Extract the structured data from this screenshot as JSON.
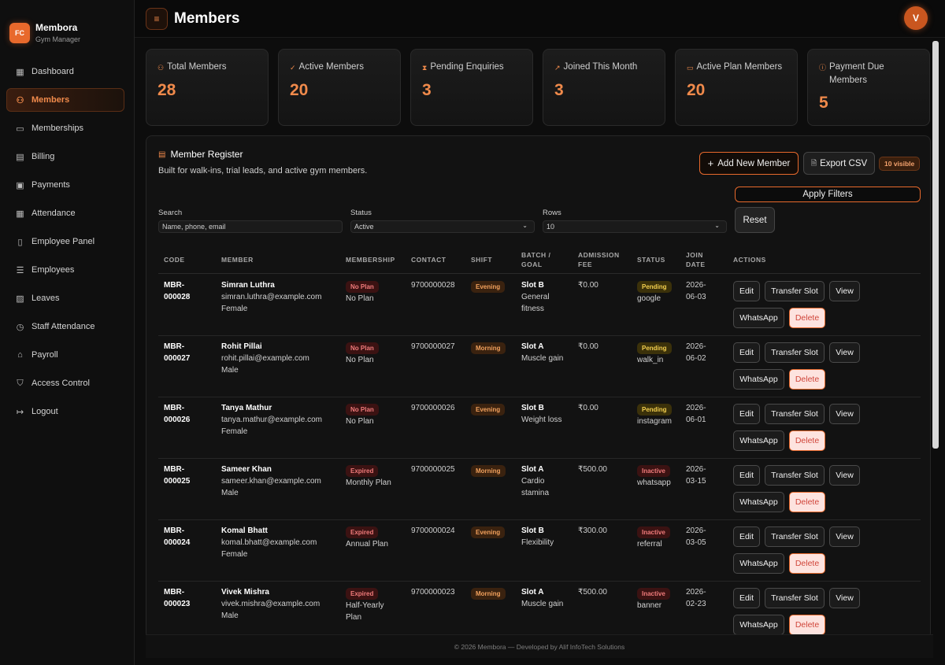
{
  "brand": {
    "logo": "FC",
    "name": "Membora",
    "sub": "Gym Manager"
  },
  "sidebar": {
    "items": [
      {
        "label": "Dashboard",
        "icon": "dashboard-icon",
        "active": false
      },
      {
        "label": "Members",
        "icon": "users-icon",
        "active": true
      },
      {
        "label": "Memberships",
        "icon": "card-icon",
        "active": false
      },
      {
        "label": "Billing",
        "icon": "billing-icon",
        "active": false
      },
      {
        "label": "Payments",
        "icon": "payments-icon",
        "active": false
      },
      {
        "label": "Attendance",
        "icon": "calendar-icon",
        "active": false
      },
      {
        "label": "Employee Panel",
        "icon": "badge-icon",
        "active": false
      },
      {
        "label": "Employees",
        "icon": "employees-icon",
        "active": false
      },
      {
        "label": "Leaves",
        "icon": "leaves-icon",
        "active": false
      },
      {
        "label": "Staff Attendance",
        "icon": "clock-icon",
        "active": false
      },
      {
        "label": "Payroll",
        "icon": "bank-icon",
        "active": false
      },
      {
        "label": "Access Control",
        "icon": "shield-icon",
        "active": false
      },
      {
        "label": "Logout",
        "icon": "logout-icon",
        "active": false
      }
    ]
  },
  "header": {
    "menu_icon": "≡",
    "title": "Members",
    "avatar": "V"
  },
  "stats": [
    {
      "label": "Total Members",
      "value": "28",
      "icon": "group-icon"
    },
    {
      "label": "Active Members",
      "value": "20",
      "icon": "user-check-icon"
    },
    {
      "label": "Pending Enquiries",
      "value": "3",
      "icon": "hourglass-icon"
    },
    {
      "label": "Joined This Month",
      "value": "3",
      "icon": "trend-icon"
    },
    {
      "label": "Active Plan Members",
      "value": "20",
      "icon": "plan-icon"
    },
    {
      "label": "Payment Due Members",
      "value": "5",
      "icon": "alert-icon"
    }
  ],
  "register": {
    "title": "Member Register",
    "subtitle": "Built for walk-ins, trial leads, and active gym members.",
    "add_label": "Add New Member",
    "export_label": "Export CSV",
    "visible_badge": "10 visible",
    "apply_label": "Apply Filters",
    "reset_label": "Reset",
    "filters": {
      "search_label": "Search",
      "search_placeholder": "Name, phone, email",
      "status_label": "Status",
      "status_value": "Active",
      "rows_label": "Rows",
      "rows_value": "10"
    }
  },
  "table": {
    "headers": {
      "code": "CODE",
      "member": "MEMBER",
      "membership": "MEMBERSHIP",
      "contact": "CONTACT",
      "shift": "SHIFT",
      "batch1": "BATCH /",
      "batch2": "GOAL",
      "fee1": "ADMISSION",
      "fee2": "FEE",
      "status": "STATUS",
      "join1": "JOIN",
      "join2": "DATE",
      "actions": "ACTIONS"
    },
    "actions": {
      "edit": "Edit",
      "transfer": "Transfer Slot",
      "view": "View",
      "whatsapp": "WhatsApp",
      "delete": "Delete"
    },
    "rows": [
      {
        "code1": "MBR-",
        "code2": "000028",
        "name": "Simran Luthra",
        "email": "simran.luthra@example.com",
        "gender": "Female",
        "plan_badge": "No Plan",
        "plan1": "No Plan",
        "plan2": "",
        "contact": "9700000028",
        "shift": "Evening",
        "slot": "Slot B",
        "goal1": "General",
        "goal2": "fitness",
        "fee": "₹0.00",
        "status": "Pending",
        "source": "google",
        "join1": "2026-",
        "join2": "06-03"
      },
      {
        "code1": "MBR-",
        "code2": "000027",
        "name": "Rohit Pillai",
        "email": "rohit.pillai@example.com",
        "gender": "Male",
        "plan_badge": "No Plan",
        "plan1": "No Plan",
        "plan2": "",
        "contact": "9700000027",
        "shift": "Morning",
        "slot": "Slot A",
        "goal1": "Muscle gain",
        "goal2": "",
        "fee": "₹0.00",
        "status": "Pending",
        "source": "walk_in",
        "join1": "2026-",
        "join2": "06-02"
      },
      {
        "code1": "MBR-",
        "code2": "000026",
        "name": "Tanya Mathur",
        "email": "tanya.mathur@example.com",
        "gender": "Female",
        "plan_badge": "No Plan",
        "plan1": "No Plan",
        "plan2": "",
        "contact": "9700000026",
        "shift": "Evening",
        "slot": "Slot B",
        "goal1": "Weight loss",
        "goal2": "",
        "fee": "₹0.00",
        "status": "Pending",
        "source": "instagram",
        "join1": "2026-",
        "join2": "06-01"
      },
      {
        "code1": "MBR-",
        "code2": "000025",
        "name": "Sameer Khan",
        "email": "sameer.khan@example.com",
        "gender": "Male",
        "plan_badge": "Expired",
        "plan1": "Monthly Plan",
        "plan2": "",
        "contact": "9700000025",
        "shift": "Morning",
        "slot": "Slot A",
        "goal1": "Cardio",
        "goal2": "stamina",
        "fee": "₹500.00",
        "status": "Inactive",
        "source": "whatsapp",
        "join1": "2026-",
        "join2": "03-15"
      },
      {
        "code1": "MBR-",
        "code2": "000024",
        "name": "Komal Bhatt",
        "email": "komal.bhatt@example.com",
        "gender": "Female",
        "plan_badge": "Expired",
        "plan1": "Annual Plan",
        "plan2": "",
        "contact": "9700000024",
        "shift": "Evening",
        "slot": "Slot B",
        "goal1": "Flexibility",
        "goal2": "",
        "fee": "₹300.00",
        "status": "Inactive",
        "source": "referral",
        "join1": "2026-",
        "join2": "03-05"
      },
      {
        "code1": "MBR-",
        "code2": "000023",
        "name": "Vivek Mishra",
        "email": "vivek.mishra@example.com",
        "gender": "Male",
        "plan_badge": "Expired",
        "plan1": "Half-Yearly",
        "plan2": "Plan",
        "contact": "9700000023",
        "shift": "Morning",
        "slot": "Slot A",
        "goal1": "Muscle gain",
        "goal2": "",
        "fee": "₹500.00",
        "status": "Inactive",
        "source": "banner",
        "join1": "2026-",
        "join2": "02-23"
      }
    ]
  },
  "footer": "© 2026 Membora — Developed by Alif InfoTech Solutions",
  "colors": {
    "accent": "#e8692c",
    "background": "#0d0d0d",
    "panel": "#121212"
  }
}
